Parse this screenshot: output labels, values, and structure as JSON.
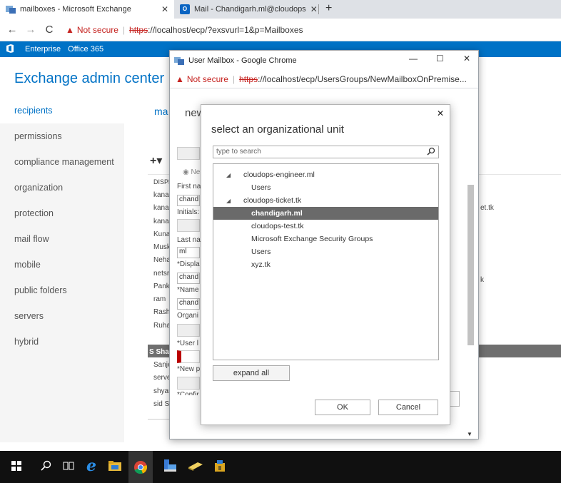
{
  "browser": {
    "tabs": [
      {
        "label": "mailboxes - Microsoft Exchange",
        "active": true
      },
      {
        "label": "Mail - Chandigarh.ml@cloudops",
        "active": false
      }
    ],
    "address": {
      "not_secure": "Not secure",
      "scheme": "https",
      "rest": "://localhost/ecp/?exsvurl=1&p=Mailboxes"
    }
  },
  "o365": {
    "enterprise": "Enterprise",
    "office": "Office 365"
  },
  "eac": {
    "title": "Exchange admin center",
    "nav": [
      "recipients",
      "permissions",
      "compliance management",
      "organization",
      "protection",
      "mail flow",
      "mobile",
      "public folders",
      "servers",
      "hybrid"
    ],
    "header_partial": "ma",
    "list_fragments": [
      "DISPL",
      "kana",
      "kana",
      "kana",
      "Kuna",
      "Musk",
      "Neha",
      "netsr",
      "Pank",
      "ram",
      "Rash",
      "Ruha",
      "S Sha",
      "Sanje",
      "serve",
      "shyar",
      "sid Sl"
    ],
    "right_fragments": [
      "et.tk",
      "k"
    ]
  },
  "popup": {
    "title": "User Mailbox - Google Chrome",
    "address": {
      "not_secure": "Not secure",
      "scheme": "https",
      "rest": "://localhost/ecp/UsersGroups/NewMailboxOnPremise..."
    },
    "form_header": "new",
    "radio_label": "Ne",
    "labels": [
      "First na",
      "Initials:",
      "Last na",
      "*Displa",
      "*Name",
      "Organi",
      "*User l",
      "*New p",
      "*Confir"
    ],
    "values": [
      "chand",
      "ml",
      "chand",
      "chand"
    ]
  },
  "ou_dialog": {
    "title": "select an organizational unit",
    "search_placeholder": "type to search",
    "tree": [
      {
        "label": "cloudops-engineer.ml",
        "level": 0,
        "expanded": true,
        "selected": false
      },
      {
        "label": "Users",
        "level": 1,
        "expanded": false,
        "selected": false
      },
      {
        "label": "cloudops-ticket.tk",
        "level": 0,
        "expanded": true,
        "selected": false
      },
      {
        "label": "chandigarh.ml",
        "level": 1,
        "expanded": false,
        "selected": true
      },
      {
        "label": "cloudops-test.tk",
        "level": 1,
        "expanded": false,
        "selected": false
      },
      {
        "label": "Microsoft Exchange Security Groups",
        "level": 1,
        "expanded": false,
        "selected": false
      },
      {
        "label": "Users",
        "level": 1,
        "expanded": false,
        "selected": false
      },
      {
        "label": "xyz.tk",
        "level": 1,
        "expanded": false,
        "selected": false
      }
    ],
    "expand_all": "expand all",
    "ok": "OK",
    "cancel": "Cancel"
  },
  "taskbar": {
    "icons": [
      "windows-start-icon",
      "search-icon",
      "task-view-icon",
      "edge-icon",
      "file-explorer-icon",
      "chrome-icon",
      "server-manager-icon",
      "exchange-shell-icon",
      "exchange-toolbox-icon"
    ]
  },
  "colors": {
    "accent": "#0072c6",
    "insecure": "#c5221f",
    "selected_row": "#6a6a6a"
  }
}
